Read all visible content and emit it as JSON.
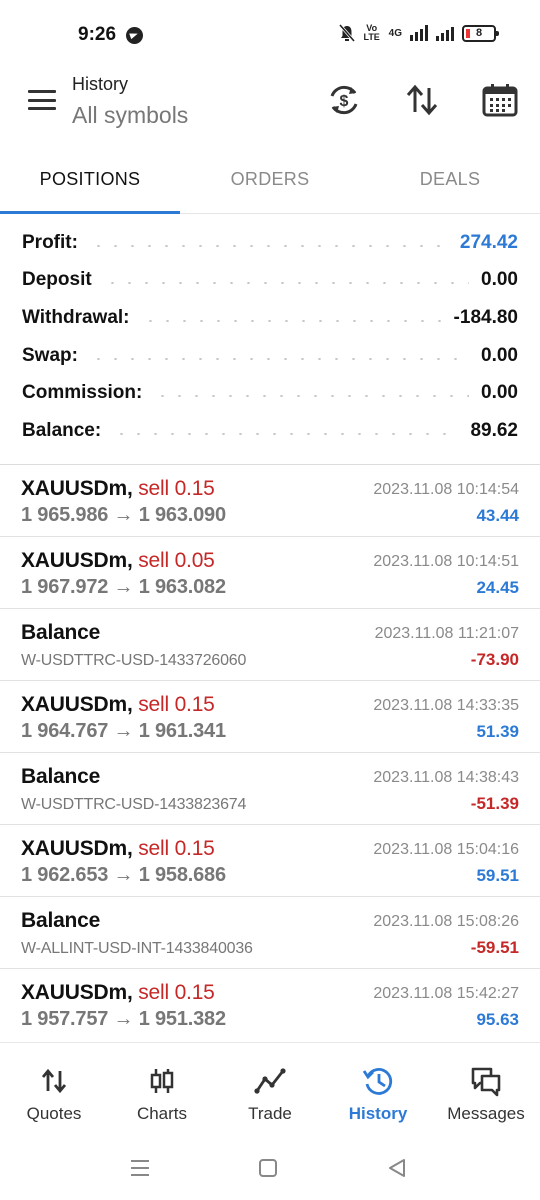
{
  "status": {
    "time": "9:26",
    "net": "4G",
    "volte": "Vo LTE",
    "battery": "8"
  },
  "header": {
    "title": "History",
    "subtitle": "All symbols"
  },
  "tabs": [
    {
      "label": "POSITIONS",
      "active": true
    },
    {
      "label": "ORDERS",
      "active": false
    },
    {
      "label": "DEALS",
      "active": false
    }
  ],
  "summary": [
    {
      "label": "Profit:",
      "value": "274.42"
    },
    {
      "label": "Deposit",
      "value": "0.00"
    },
    {
      "label": "Withdrawal:",
      "value": "-184.80"
    },
    {
      "label": "Swap:",
      "value": "0.00"
    },
    {
      "label": "Commission:",
      "value": "0.00"
    },
    {
      "label": "Balance:",
      "value": "89.62"
    }
  ],
  "items": [
    {
      "symbol": "XAUUSDm,",
      "side": "sell 0.15",
      "line2": "1 965.986 → 1 963.090",
      "time": "2023.11.08 10:14:54",
      "pl": "43.44"
    },
    {
      "symbol": "XAUUSDm,",
      "side": "sell 0.05",
      "line2": "1 967.972 → 1 963.082",
      "time": "2023.11.08 10:14:51",
      "pl": "24.45"
    },
    {
      "symbol": "Balance",
      "side": "",
      "line2": "W-USDTTRC-USD-1433726060",
      "time": "2023.11.08 11:21:07",
      "pl": "-73.90"
    },
    {
      "symbol": "XAUUSDm,",
      "side": "sell 0.15",
      "line2": "1 964.767 → 1 961.341",
      "time": "2023.11.08 14:33:35",
      "pl": "51.39"
    },
    {
      "symbol": "Balance",
      "side": "",
      "line2": "W-USDTTRC-USD-1433823674",
      "time": "2023.11.08 14:38:43",
      "pl": "-51.39"
    },
    {
      "symbol": "XAUUSDm,",
      "side": "sell 0.15",
      "line2": "1 962.653 → 1 958.686",
      "time": "2023.11.08 15:04:16",
      "pl": "59.51"
    },
    {
      "symbol": "Balance",
      "side": "",
      "line2": "W-ALLINT-USD-INT-1433840036",
      "time": "2023.11.08 15:08:26",
      "pl": "-59.51"
    },
    {
      "symbol": "XAUUSDm,",
      "side": "sell 0.15",
      "line2": "1 957.757 → 1 951.382",
      "time": "2023.11.08 15:42:27",
      "pl": "95.63"
    }
  ],
  "nav": [
    {
      "label": "Quotes",
      "icon": "quotes-arrows-icon",
      "active": false
    },
    {
      "label": "Charts",
      "icon": "candlestick-icon",
      "active": false
    },
    {
      "label": "Trade",
      "icon": "trade-line-icon",
      "active": false
    },
    {
      "label": "History",
      "icon": "history-clock-icon",
      "active": true
    },
    {
      "label": "Messages",
      "icon": "messages-chat-icon",
      "active": false
    }
  ],
  "colors": {
    "accent": "#2c7ad6",
    "loss": "#c62828",
    "muted": "#777777"
  }
}
